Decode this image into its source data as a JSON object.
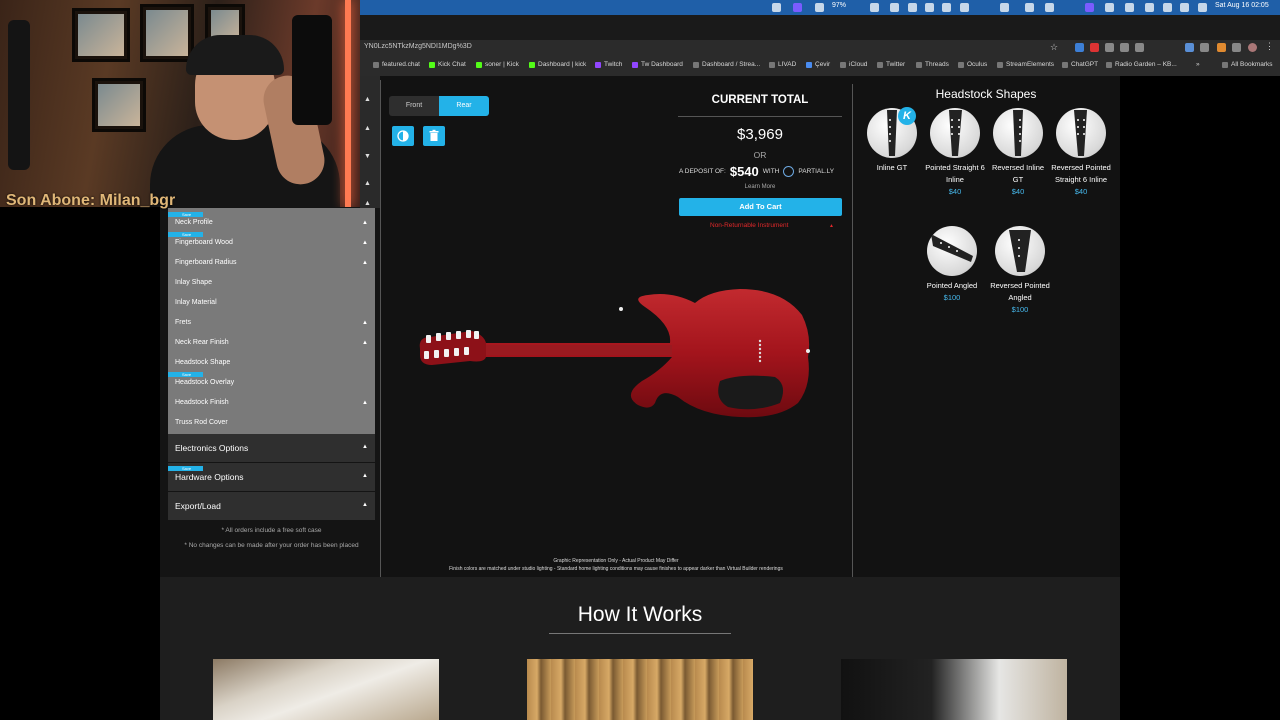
{
  "menubar": {
    "battery": "97%",
    "datetime": "Sat Aug 16  02:05"
  },
  "browser": {
    "url": "YN0Lzc5NTkzMzg5NDI1MDg%3D",
    "bookmarks": [
      "featured.chat",
      "Kick Chat",
      "soner | Kick",
      "Dashboard | kick",
      "Twitch",
      "Tw Dashboard",
      "Dashboard / Strea...",
      "LIVAD",
      "Çevir",
      "iCloud",
      "Twitter",
      "Threads",
      "Oculus",
      "StreamElements",
      "ChatGPT",
      "Radio Garden – KB...",
      "All Bookmarks"
    ],
    "more": "»"
  },
  "webcam": {
    "overlay_text": "Son Abone: Milan_bgr"
  },
  "sidebar": {
    "save_badge": "Save",
    "sub_items": [
      {
        "label": "Neck Profile",
        "chevron": true
      },
      {
        "label": "Fingerboard Wood",
        "chevron": true
      },
      {
        "label": "Fingerboard Radius",
        "chevron": true
      },
      {
        "label": "Inlay Shape",
        "chevron": false
      },
      {
        "label": "Inlay Material",
        "chevron": false
      },
      {
        "label": "Frets",
        "chevron": true
      },
      {
        "label": "Neck Rear Finish",
        "chevron": true
      },
      {
        "label": "Headstock Shape",
        "chevron": false
      },
      {
        "label": "Headstock Overlay",
        "chevron": false
      },
      {
        "label": "Headstock Finish",
        "chevron": true
      },
      {
        "label": "Truss Rod Cover",
        "chevron": false
      }
    ],
    "sections": [
      "Electronics Options",
      "Hardware Options",
      "Export/Load"
    ],
    "notes": [
      "* All orders include a free soft case",
      "* No changes can be made after your order has been placed"
    ]
  },
  "viewer": {
    "front_label": "Front",
    "rear_label": "Rear",
    "active_view": "Rear",
    "disclaimer1": "Graphic Representation Only - Actual Product May Differ",
    "disclaimer2": "Finish colors are matched under studio lighting - Standard home lighting conditions may cause finishes to appear darker than Virtual Builder renderings"
  },
  "total": {
    "title": "CURRENT TOTAL",
    "price": "$3,969",
    "or": "OR",
    "deposit_prefix": "A DEPOSIT OF:",
    "deposit_amount": "$540",
    "deposit_with": "WITH",
    "partially": "PARTIAL.LY",
    "learn_more": "Learn More",
    "add_to_cart": "Add To Cart",
    "non_returnable": "Non-Returnable Instrument"
  },
  "headstock": {
    "title": "Headstock Shapes",
    "selected_badge": "K",
    "options": [
      {
        "name": "Inline GT",
        "price": ""
      },
      {
        "name": "Pointed Straight 6 Inline",
        "price": "$40"
      },
      {
        "name": "Reversed Inline GT",
        "price": "$40"
      },
      {
        "name": "Reversed Pointed Straight 6 Inline",
        "price": "$40"
      },
      {
        "name": "Pointed Angled",
        "price": "$100"
      },
      {
        "name": "Reversed Pointed Angled",
        "price": "$100"
      }
    ]
  },
  "how_it_works": {
    "title": "How It Works"
  },
  "colors": {
    "accent": "#23b2e8",
    "danger": "#e0282a",
    "guitar_body": "#a3141c"
  }
}
